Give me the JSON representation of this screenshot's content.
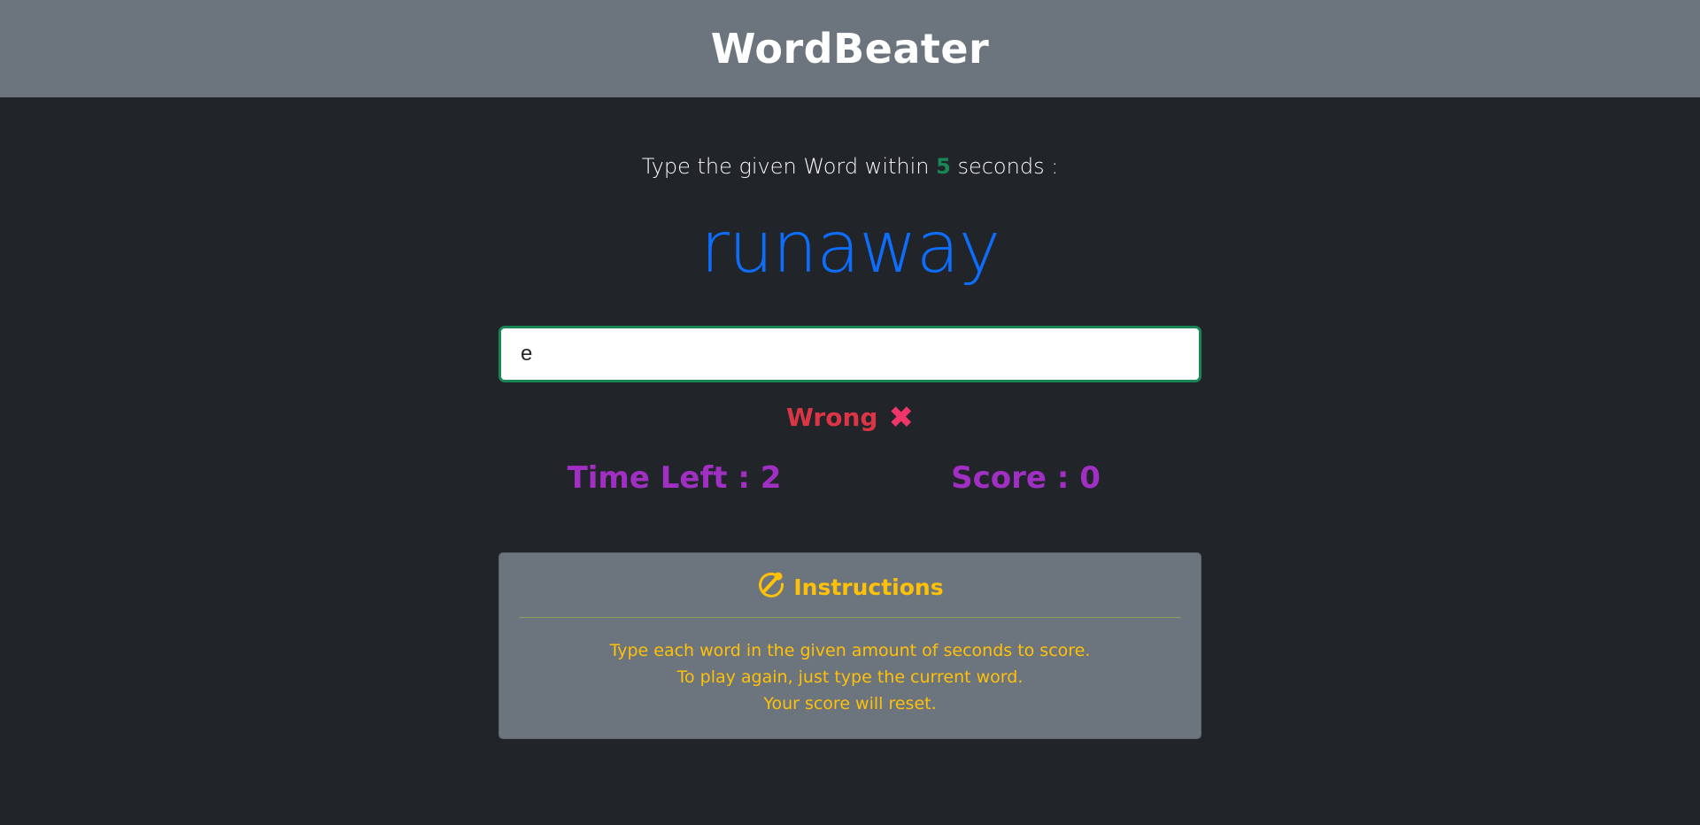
{
  "header": {
    "title": "WordBeater"
  },
  "prompt": {
    "before": "Type the given Word within",
    "seconds": "5",
    "after": "seconds :"
  },
  "current_word": "runaway",
  "input": {
    "value": "e",
    "placeholder": ""
  },
  "status": {
    "text": "Wrong",
    "icon": "cross-mark-icon",
    "icon_glyph": "✖"
  },
  "stats": {
    "time_left": "Time Left : 2",
    "score": "Score : 0"
  },
  "instructions": {
    "icon": "pen-circle-icon",
    "title": "Instructions",
    "lines": [
      "Type each word in the given amount of seconds to score.",
      "To play again, just type the current word.",
      "Your score will reset."
    ]
  },
  "colors": {
    "background": "#212529",
    "header": "#6c757d",
    "word": "#0d6efd",
    "accent_green": "#198754",
    "wrong": "#dc3545",
    "stats": "#a22fc4",
    "instructions": "#ffc107"
  }
}
